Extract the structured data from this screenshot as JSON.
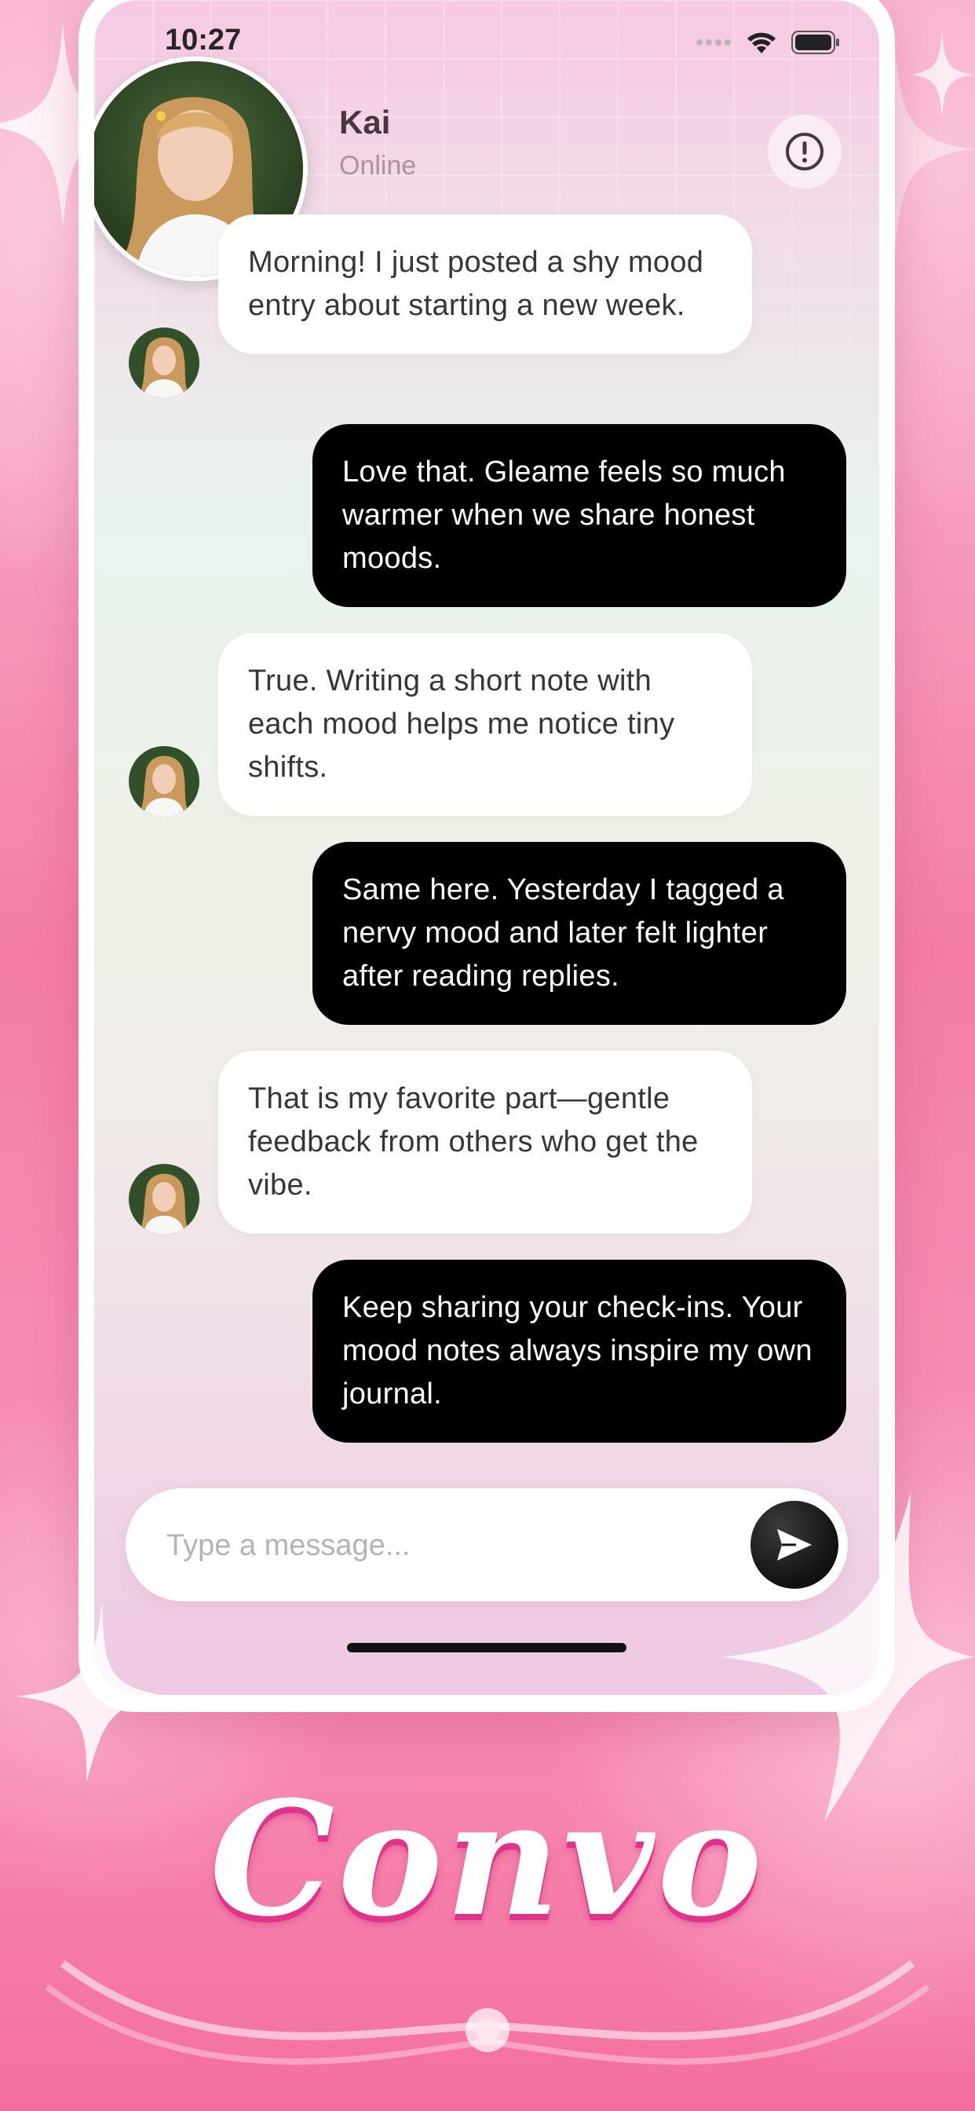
{
  "status_bar": {
    "time": "10:27"
  },
  "header": {
    "name": "Kai",
    "status": "Online",
    "info_icon": "info-circle-icon"
  },
  "messages": [
    {
      "side": "in",
      "text": "Morning! I just posted a shy mood entry about starting a new week."
    },
    {
      "side": "out",
      "text": "Love that. Gleame feels so much warmer when we share honest moods."
    },
    {
      "side": "in",
      "text": "True. Writing a short note with each mood helps me notice tiny shifts."
    },
    {
      "side": "out",
      "text": "Same here. Yesterday I tagged a nervy mood and later felt lighter after reading replies."
    },
    {
      "side": "in",
      "text": "That is my favorite part—gentle feedback from others who get the vibe."
    },
    {
      "side": "out",
      "text": "Keep sharing your check-ins. Your mood notes always inspire my own journal."
    }
  ],
  "composer": {
    "placeholder": "Type a message...",
    "send_icon": "send-icon"
  },
  "branding": {
    "logo_text": "Convo"
  },
  "colors": {
    "background_pink": "#f58bb2",
    "outgoing_bubble": "#000000",
    "incoming_bubble": "#ffffff",
    "logo_shadow": "#e2338c"
  }
}
